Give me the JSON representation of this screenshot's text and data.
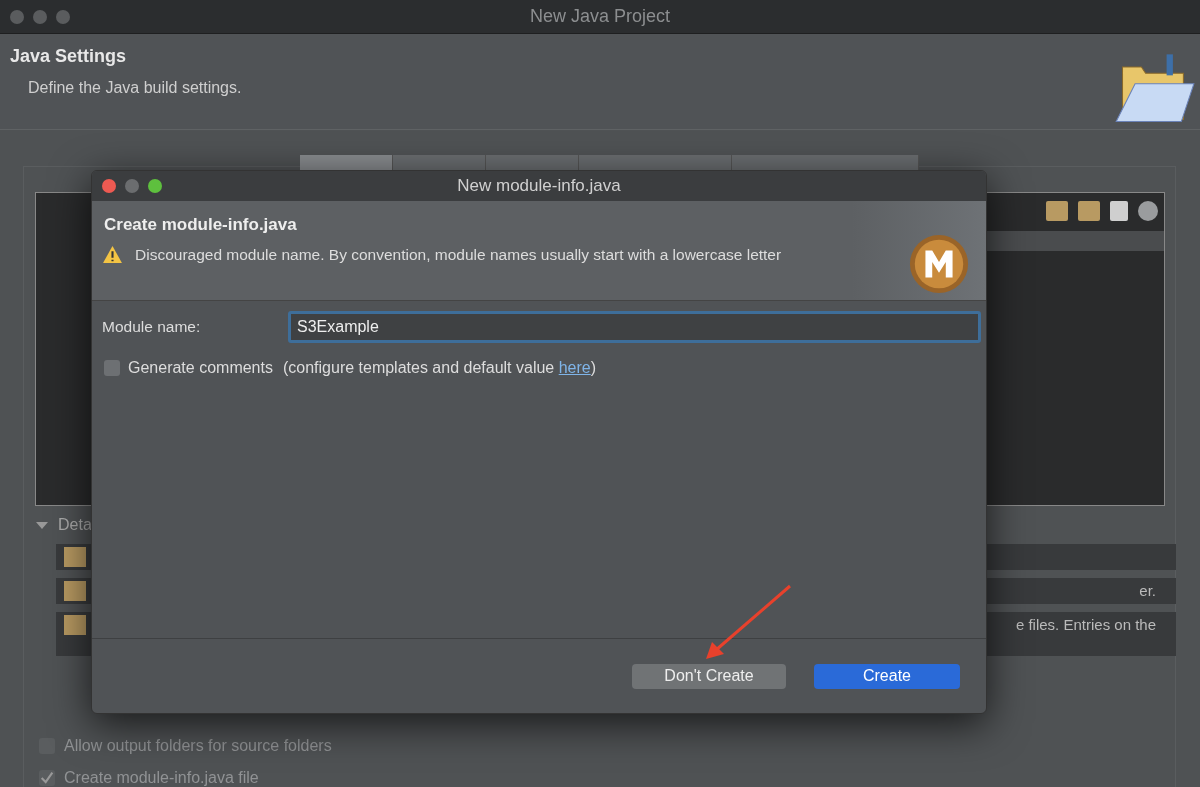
{
  "window": {
    "title": "New Java Project"
  },
  "header": {
    "title": "Java Settings",
    "subtitle": "Define the Java build settings."
  },
  "tabs": [
    {
      "selected": true
    },
    {
      "selected": false
    },
    {
      "selected": false
    },
    {
      "selected": false
    },
    {
      "selected": false
    }
  ],
  "details": {
    "label": "Deta",
    "rows": [
      "",
      "er.",
      "e files. Entries on the"
    ]
  },
  "options": [
    {
      "label": "Allow output folders for source folders",
      "checked": false
    },
    {
      "label": "Create module-info.java file",
      "checked": true
    }
  ],
  "dialog": {
    "title": "New module-info.java",
    "heading": "Create module-info.java",
    "warning": "Discouraged module name. By convention, module names usually start with a lowercase letter",
    "module_label": "Module name:",
    "module_value": "S3Example",
    "generate_comments": {
      "label": "Generate comments",
      "checked": false
    },
    "hint": "(configure templates and default value ",
    "hint_link": "here",
    "hint_end": ")",
    "buttons": [
      {
        "label": "Don't Create",
        "kind": "secondary"
      },
      {
        "label": "Create",
        "kind": "primary"
      }
    ]
  }
}
